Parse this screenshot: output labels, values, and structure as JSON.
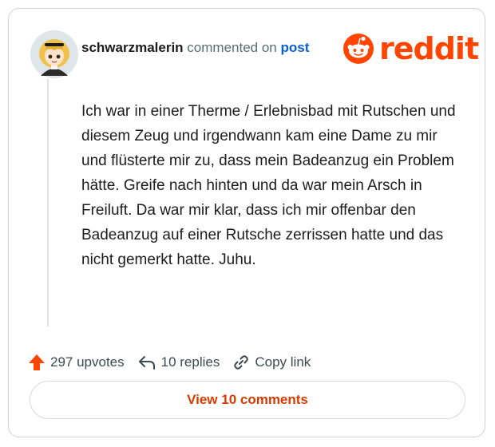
{
  "post_header": {
    "username": "schwarzmalerin",
    "action_text": "commented on",
    "post_link": "post"
  },
  "brand": {
    "logo_text": "reddit",
    "icon": "reddit-snoo-icon",
    "color": "#ff4500"
  },
  "comment": {
    "body": "Ich war in einer Therme / Erlebnisbad mit Rutschen und diesem Zeug und irgendwann kam eine Dame zu mir und flüsterte mir zu, dass mein Badeanzug ein Problem hätte. Greife nach hinten und da war mein Arsch in Freiluft. Da war mir klar, dass ich mir offenbar den Badeanzug auf einer Rutsche zerrissen hatte und das nicht gemerkt hatte. Juhu."
  },
  "actions": {
    "upvotes": "297 upvotes",
    "replies": "10 replies",
    "copy_link": "Copy link",
    "upvote_icon": "upvote-arrow-icon",
    "reply_icon": "reply-arrow-icon",
    "link_icon": "link-icon",
    "upvote_color": "#ff4500"
  },
  "view_comments_label": "View 10 comments",
  "colors": {
    "accent_link": "#0a5fd8",
    "button_text": "#d93a00"
  }
}
